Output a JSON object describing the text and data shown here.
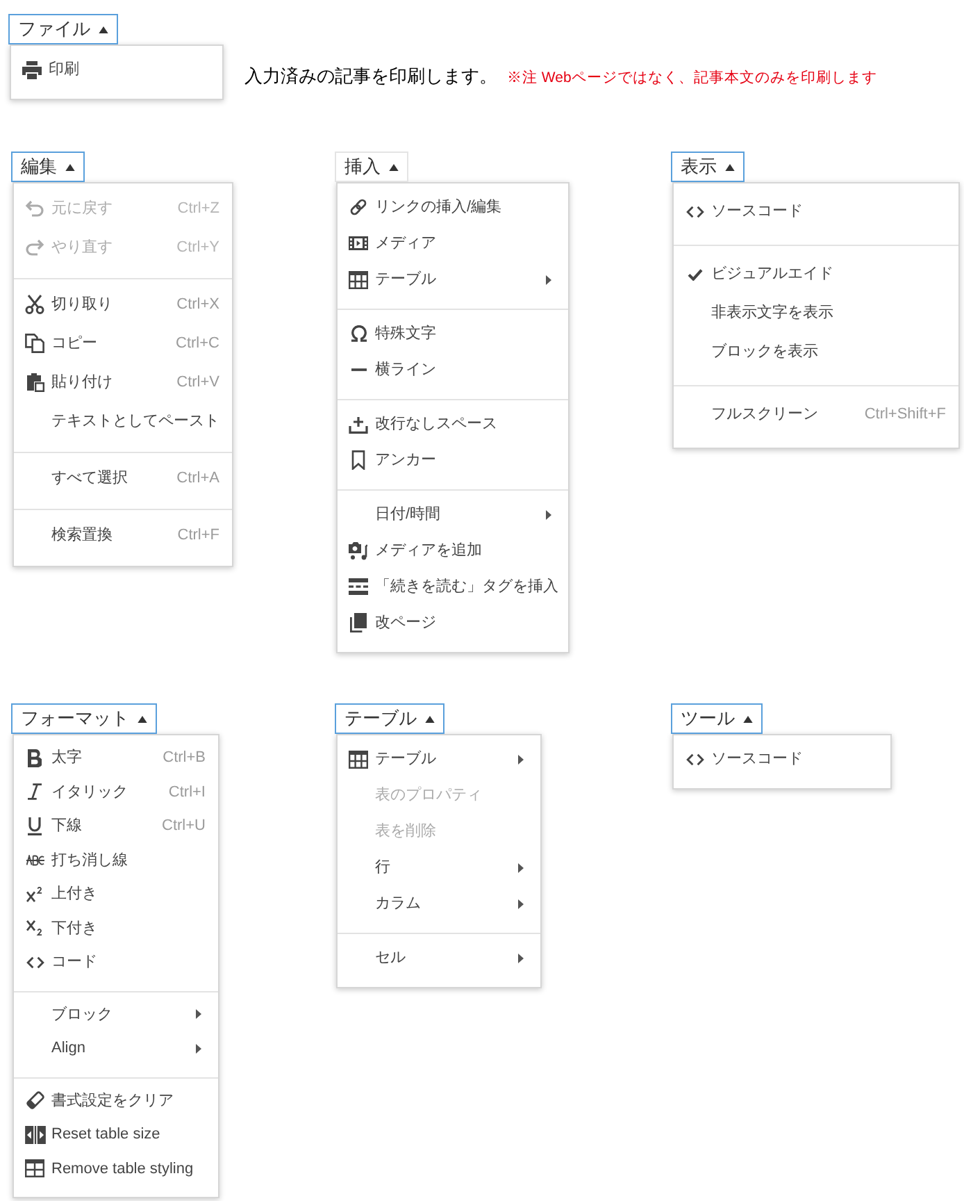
{
  "menus": [
    {
      "label": "ファイル",
      "focused": true,
      "sections": [
        [
          {
            "label": "印刷",
            "disabled": false,
            "submenu": false
          }
        ]
      ],
      "caption": {
        "text": "入力済みの記事を印刷します。",
        "note": "※注 Webページではなく、記事本文のみを印刷します"
      }
    },
    {
      "label": "編集",
      "focused": true,
      "sections": [
        [
          {
            "label": "元に戻す",
            "shortcut": "Ctrl+Z",
            "disabled": true,
            "submenu": false
          },
          {
            "label": "やり直す",
            "shortcut": "Ctrl+Y",
            "disabled": true,
            "submenu": false
          }
        ],
        [
          {
            "label": "切り取り",
            "shortcut": "Ctrl+X",
            "disabled": false,
            "submenu": false
          },
          {
            "label": "コピー",
            "shortcut": "Ctrl+C",
            "disabled": false,
            "submenu": false
          },
          {
            "label": "貼り付け",
            "shortcut": "Ctrl+V",
            "disabled": false,
            "submenu": false
          },
          {
            "label": "テキストとしてペースト",
            "disabled": false,
            "submenu": false
          }
        ],
        [
          {
            "label": "すべて選択",
            "shortcut": "Ctrl+A",
            "disabled": false,
            "submenu": false
          }
        ],
        [
          {
            "label": "検索置換",
            "shortcut": "Ctrl+F",
            "disabled": false,
            "submenu": false
          }
        ]
      ]
    },
    {
      "label": "挿入",
      "focused": false,
      "sections": [
        [
          {
            "label": "リンクの挿入/編集",
            "disabled": false,
            "submenu": false
          },
          {
            "label": "メディア",
            "disabled": false,
            "submenu": false
          },
          {
            "label": "テーブル",
            "disabled": false,
            "submenu": true
          }
        ],
        [
          {
            "label": "特殊文字",
            "disabled": false,
            "submenu": false
          },
          {
            "label": "横ライン",
            "disabled": false,
            "submenu": false
          }
        ],
        [
          {
            "label": "改行なしスペース",
            "disabled": false,
            "submenu": false
          },
          {
            "label": "アンカー",
            "disabled": false,
            "submenu": false
          }
        ],
        [
          {
            "label": "日付/時間",
            "disabled": false,
            "submenu": true
          },
          {
            "label": "メディアを追加",
            "disabled": false,
            "submenu": false
          },
          {
            "label": "「続きを読む」タグを挿入",
            "disabled": false,
            "submenu": false
          },
          {
            "label": "改ページ",
            "disabled": false,
            "submenu": false
          }
        ]
      ]
    },
    {
      "label": "表示",
      "focused": true,
      "sections": [
        [
          {
            "label": "ソースコード",
            "disabled": false,
            "submenu": false,
            "checked": false
          }
        ],
        [
          {
            "label": "ビジュアルエイド",
            "disabled": false,
            "submenu": false,
            "checked": true
          },
          {
            "label": "非表示文字を表示",
            "disabled": false,
            "submenu": false,
            "checked": false
          },
          {
            "label": "ブロックを表示",
            "disabled": false,
            "submenu": false,
            "checked": false
          }
        ],
        [
          {
            "label": "フルスクリーン",
            "shortcut": "Ctrl+Shift+F",
            "disabled": false,
            "submenu": false,
            "checked": false
          }
        ]
      ]
    },
    {
      "label": "フォーマット",
      "focused": true,
      "sections": [
        [
          {
            "label": "太字",
            "shortcut": "Ctrl+B",
            "disabled": false,
            "submenu": false
          },
          {
            "label": "イタリック",
            "shortcut": "Ctrl+I",
            "disabled": false,
            "submenu": false
          },
          {
            "label": "下線",
            "shortcut": "Ctrl+U",
            "disabled": false,
            "submenu": false
          },
          {
            "label": "打ち消し線",
            "disabled": false,
            "submenu": false
          },
          {
            "label": "上付き",
            "disabled": false,
            "submenu": false
          },
          {
            "label": "下付き",
            "disabled": false,
            "submenu": false
          },
          {
            "label": "コード",
            "disabled": false,
            "submenu": false
          }
        ],
        [
          {
            "label": "ブロック",
            "disabled": false,
            "submenu": true
          },
          {
            "label": "Align",
            "disabled": false,
            "submenu": true
          }
        ],
        [
          {
            "label": "書式設定をクリア",
            "disabled": false,
            "submenu": false
          },
          {
            "label": "Reset table size",
            "disabled": false,
            "submenu": false
          },
          {
            "label": "Remove table styling",
            "disabled": false,
            "submenu": false
          }
        ]
      ]
    },
    {
      "label": "テーブル",
      "focused": true,
      "sections": [
        [
          {
            "label": "テーブル",
            "disabled": false,
            "submenu": true
          },
          {
            "label": "表のプロパティ",
            "disabled": true,
            "submenu": false
          },
          {
            "label": "表を削除",
            "disabled": true,
            "submenu": false
          },
          {
            "label": "行",
            "disabled": false,
            "submenu": true
          },
          {
            "label": "カラム",
            "disabled": false,
            "submenu": true
          }
        ],
        [
          {
            "label": "セル",
            "disabled": false,
            "submenu": true
          }
        ]
      ]
    },
    {
      "label": "ツール",
      "focused": true,
      "sections": [
        [
          {
            "label": "ソースコード",
            "disabled": false,
            "submenu": false
          }
        ]
      ]
    }
  ]
}
